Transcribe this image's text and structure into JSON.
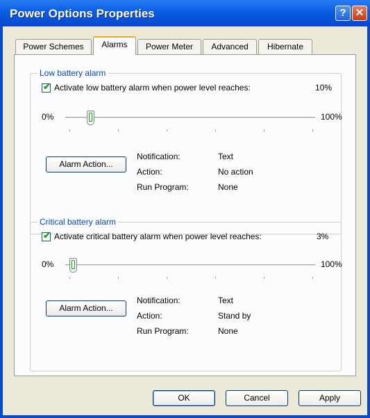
{
  "window": {
    "title": "Power Options Properties"
  },
  "titlebar": {
    "help_glyph": "?",
    "close_glyph": "✕"
  },
  "tabs": [
    {
      "label": "Power Schemes"
    },
    {
      "label": "Alarms"
    },
    {
      "label": "Power Meter"
    },
    {
      "label": "Advanced"
    },
    {
      "label": "Hibernate"
    }
  ],
  "low_alarm": {
    "group_label": "Low battery alarm",
    "checkbox_label": "Activate low battery alarm when power level reaches:",
    "checked": true,
    "level_text": "10%",
    "slider_min": "0%",
    "slider_max": "100%",
    "slider_value": 10,
    "action_button": "Alarm Action...",
    "notification_label": "Notification:",
    "notification_value": "Text",
    "action_label": "Action:",
    "action_value": "No action",
    "run_label": "Run Program:",
    "run_value": "None"
  },
  "critical_alarm": {
    "group_label": "Critical battery alarm",
    "checkbox_label": "Activate critical battery alarm when power level reaches:",
    "checked": true,
    "level_text": "3%",
    "slider_min": "0%",
    "slider_max": "100%",
    "slider_value": 3,
    "action_button": "Alarm Action...",
    "notification_label": "Notification:",
    "notification_value": "Text",
    "action_label": "Action:",
    "action_value": "Stand by",
    "run_label": "Run Program:",
    "run_value": "None"
  },
  "footer": {
    "ok": "OK",
    "cancel": "Cancel",
    "apply": "Apply"
  },
  "colors": {
    "titlebar": "#0b5fe6",
    "dialog_bg": "#ece9d8",
    "active_tab_accent": "#f5a623",
    "group_label": "#0046d5",
    "check_green": "#21a121"
  }
}
